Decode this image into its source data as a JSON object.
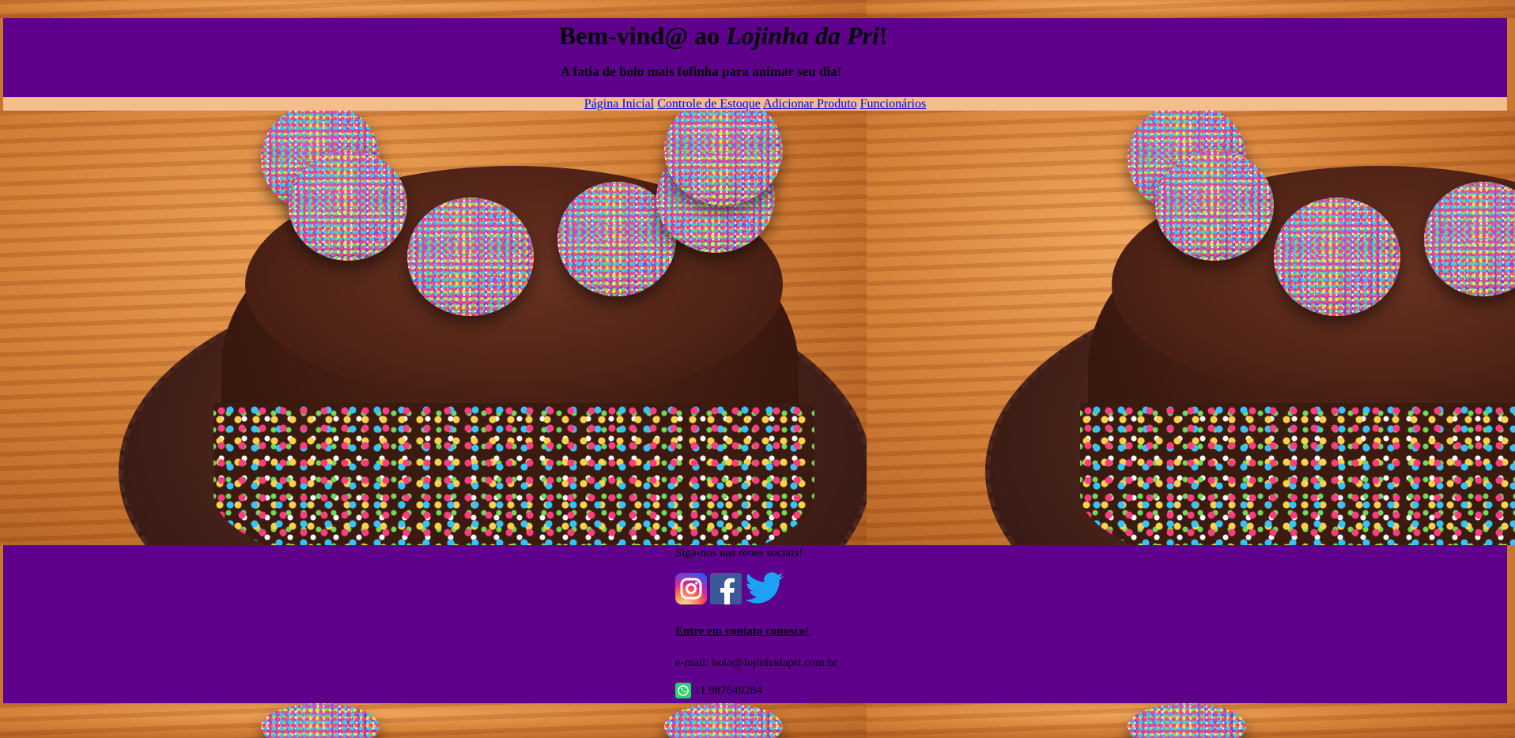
{
  "header": {
    "welcome_prefix": "Bem-vind@ ao ",
    "store_name": "Lojinha da Pri",
    "welcome_suffix": "!",
    "tagline": "A fatia de bolo mais fofinha para animar seu dia!"
  },
  "nav": {
    "items": [
      {
        "label": "Página Inicial"
      },
      {
        "label": "Controle de Estoque"
      },
      {
        "label": "Adicionar Produto"
      },
      {
        "label": "Funcionários"
      }
    ]
  },
  "footer": {
    "follow_text": "Siga-nos nas redes sociais!",
    "socials": [
      {
        "icon": "instagram-icon"
      },
      {
        "icon": "facebook-icon"
      },
      {
        "icon": "twitter-icon"
      }
    ],
    "contact_heading": "Entre em contato conosco!",
    "email_line": "e-mail: bolo@lojinhadapri.com.br",
    "phone": "11 987649284"
  },
  "colors": {
    "header_bg": "#5e008c",
    "nav_bg": "#f3bd8e",
    "link": "#0000ee"
  }
}
